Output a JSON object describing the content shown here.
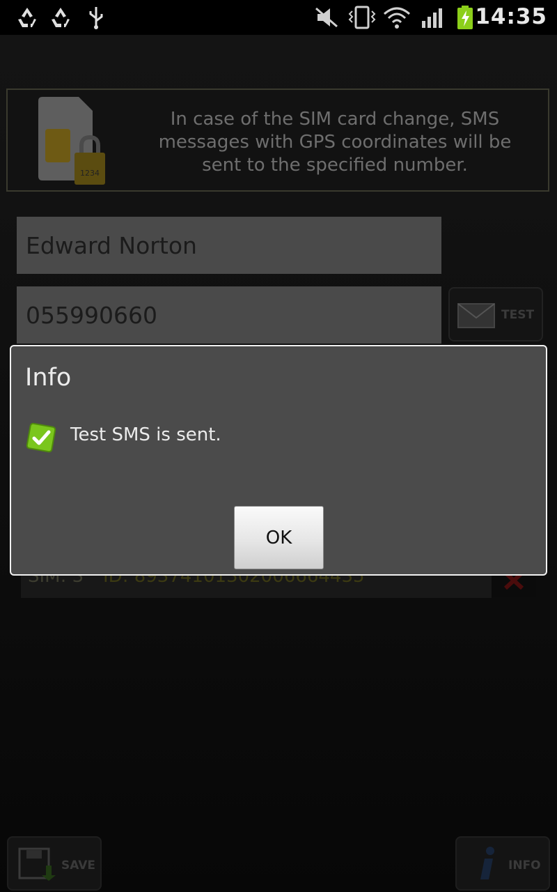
{
  "status_bar": {
    "time": "14:35",
    "icons": [
      "recycle-icon",
      "recycle-icon",
      "usb-icon",
      "mute-icon",
      "vibrate-icon",
      "wifi-icon",
      "signal-icon",
      "battery-charging-icon"
    ],
    "battery_color": "#8ccf1a"
  },
  "banner": {
    "text": "In case of the SIM card change, SMS messages with GPS coordinates will be sent to the specified number.",
    "sim_lock_code": "1234"
  },
  "form": {
    "name_value": "Edward Norton",
    "phone_value": "055990660",
    "test_label": "TEST"
  },
  "sim_entry": {
    "label": "SIM: 3",
    "id_text": "ID: 89374101302006664435"
  },
  "toolbar": {
    "save_label": "SAVE",
    "info_label": "INFO"
  },
  "dialog": {
    "title": "Info",
    "message": "Test SMS is sent.",
    "ok_label": "OK"
  }
}
